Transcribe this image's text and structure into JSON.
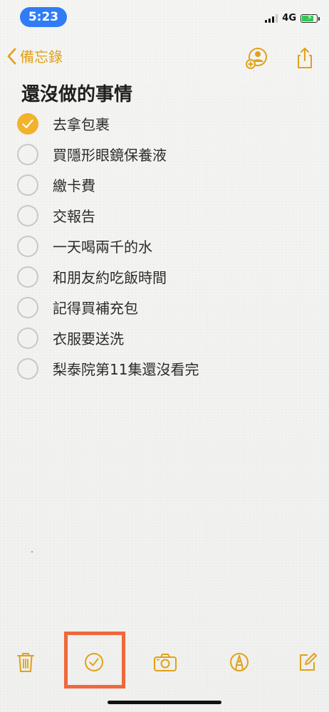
{
  "status_bar": {
    "time": "5:23",
    "network": "4G",
    "battery_level": 0.78
  },
  "nav": {
    "back_label": "備忘錄"
  },
  "note": {
    "title": "還沒做的事情",
    "items": [
      {
        "text": "去拿包裹",
        "checked": true
      },
      {
        "text": "買隱形眼鏡保養液",
        "checked": false
      },
      {
        "text": "繳卡費",
        "checked": false
      },
      {
        "text": "交報告",
        "checked": false
      },
      {
        "text": "一天喝兩千的水",
        "checked": false
      },
      {
        "text": "和朋友約吃飯時間",
        "checked": false
      },
      {
        "text": "記得買補充包",
        "checked": false
      },
      {
        "text": "衣服要送洗",
        "checked": false
      },
      {
        "text": "梨泰院第11集還沒看完",
        "checked": false
      }
    ]
  },
  "toolbar": {
    "icons": [
      "trash-icon",
      "checklist-icon",
      "camera-icon",
      "markup-icon",
      "compose-icon"
    ]
  },
  "colors": {
    "accent": "#e0a21a",
    "checked_fill": "#f2b22c",
    "highlight": "#f0683b",
    "time_pill": "#2f7cf6"
  }
}
